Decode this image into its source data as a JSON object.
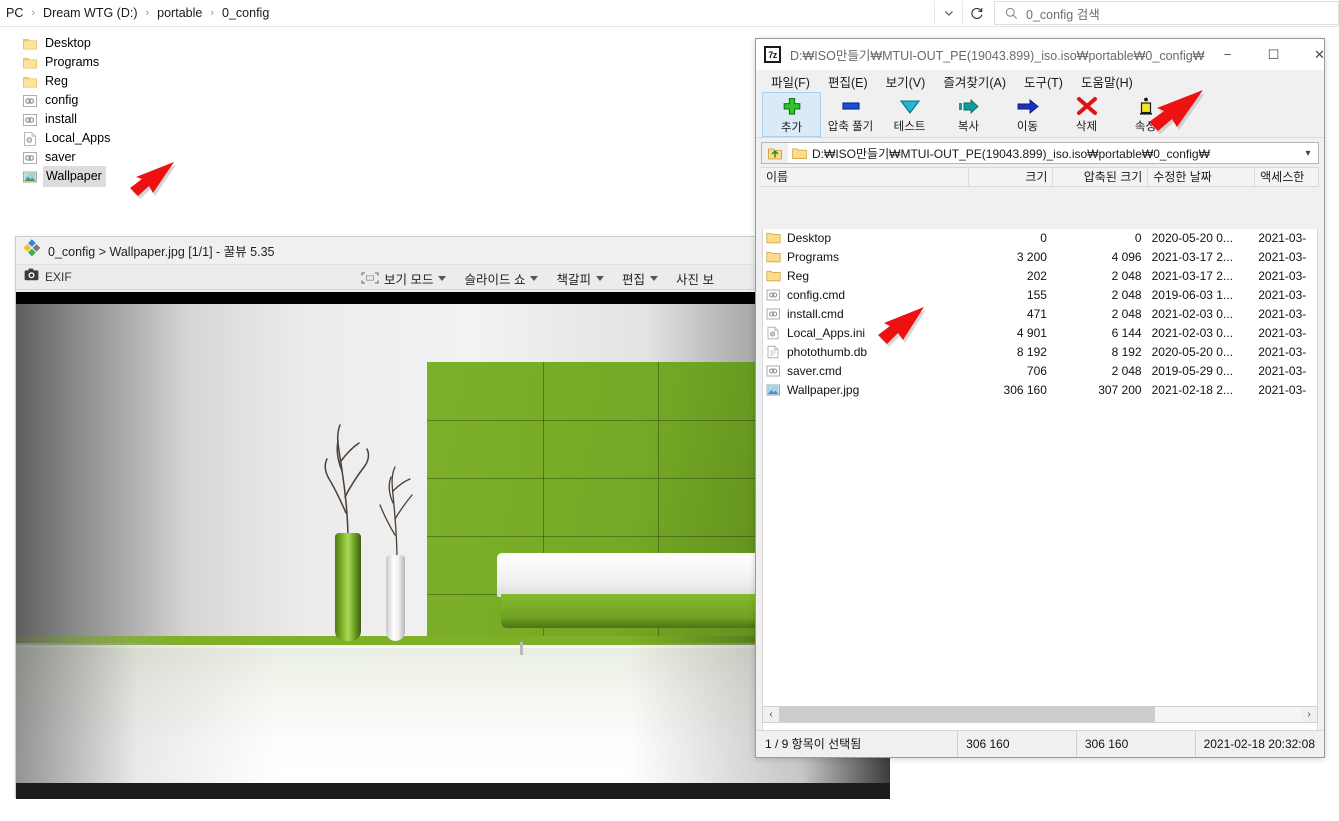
{
  "explorer": {
    "breadcrumb": {
      "items": [
        "PC",
        "Dream WTG (D:)",
        "portable",
        "0_config"
      ],
      "separator": "›"
    },
    "addressbar": {
      "dropdown_icon": "chevron-down-icon",
      "refresh_icon": "refresh-icon"
    },
    "search": {
      "placeholder": "0_config 검색",
      "value": "0_config 검색",
      "icon": "search-icon"
    },
    "items": [
      {
        "label": "Desktop",
        "icon": "folder-icon",
        "selected": false
      },
      {
        "label": "Programs",
        "icon": "folder-icon",
        "selected": false
      },
      {
        "label": "Reg",
        "icon": "folder-icon",
        "selected": false
      },
      {
        "label": "config",
        "icon": "cmd-file-icon",
        "selected": false
      },
      {
        "label": "install",
        "icon": "cmd-file-icon",
        "selected": false
      },
      {
        "label": "Local_Apps",
        "icon": "ini-file-icon",
        "selected": false
      },
      {
        "label": "saver",
        "icon": "cmd-file-icon",
        "selected": false
      },
      {
        "label": "Wallpaper",
        "icon": "image-file-icon",
        "selected": true
      }
    ]
  },
  "viewer": {
    "title": "0_config > Wallpaper.jpg [1/1] - 꿀뷰 5.35",
    "app_icon": "kkulview-diamond-icon",
    "toolbar": {
      "exif_label": "EXIF",
      "exif_icon": "camera-icon",
      "buttons": [
        {
          "label": "보기 모드",
          "icon": "fit-screen-icon",
          "has_caret": true
        },
        {
          "label": "슬라이드 쇼",
          "icon": "",
          "has_caret": true
        },
        {
          "label": "책갈피",
          "icon": "",
          "has_caret": true
        },
        {
          "label": "편집",
          "icon": "",
          "has_caret": true
        },
        {
          "label": "사진 보",
          "icon": "",
          "has_caret": false
        }
      ]
    },
    "image_description": "녹색 벽과 흰색 소파가 있는 인테리어 사진"
  },
  "sevenzip": {
    "title": "D:₩ISO만들기₩MTUI-OUT_PE(19043.899)_iso.iso₩portable₩0_config₩",
    "app_icon": "7z-icon",
    "window_controls": {
      "minimize": "−",
      "maximize": "☐",
      "close": "✕"
    },
    "menu": [
      "파일(F)",
      "편집(E)",
      "보기(V)",
      "즐겨찾기(A)",
      "도구(T)",
      "도움말(H)"
    ],
    "toolbar": [
      {
        "label": "추가",
        "icon": "plus-green-icon",
        "active": true
      },
      {
        "label": "압축 풀기",
        "icon": "extract-blue-icon",
        "active": false
      },
      {
        "label": "테스트",
        "icon": "test-chevron-icon",
        "active": false
      },
      {
        "label": "복사",
        "icon": "copy-arrow-icon",
        "active": false
      },
      {
        "label": "이동",
        "icon": "move-arrow-icon",
        "active": false
      },
      {
        "label": "삭제",
        "icon": "delete-x-icon",
        "active": false
      },
      {
        "label": "속성",
        "icon": "info-i-icon",
        "active": false
      }
    ],
    "address": {
      "value": "D:₩ISO만들기₩MTUI-OUT_PE(19043.899)_iso.iso₩portable₩0_config₩",
      "up_icon": "up-folder-icon",
      "folder_icon": "folder-icon",
      "dropdown_icon": "chevron-down-icon"
    },
    "columns": [
      "이름",
      "크기",
      "압축된 크기",
      "수정한 날짜",
      "액세스한"
    ],
    "rows": [
      {
        "name": "Desktop",
        "icon": "folder-icon",
        "size": "0",
        "packed": "0",
        "modified": "2020-05-20 0...",
        "accessed": "2021-03-"
      },
      {
        "name": "Programs",
        "icon": "folder-icon",
        "size": "3 200",
        "packed": "4 096",
        "modified": "2021-03-17 2...",
        "accessed": "2021-03-"
      },
      {
        "name": "Reg",
        "icon": "folder-icon",
        "size": "202",
        "packed": "2 048",
        "modified": "2021-03-17 2...",
        "accessed": "2021-03-"
      },
      {
        "name": "config.cmd",
        "icon": "cmd-file-icon",
        "size": "155",
        "packed": "2 048",
        "modified": "2019-06-03 1...",
        "accessed": "2021-03-"
      },
      {
        "name": "install.cmd",
        "icon": "cmd-file-icon",
        "size": "471",
        "packed": "2 048",
        "modified": "2021-02-03 0...",
        "accessed": "2021-03-"
      },
      {
        "name": "Local_Apps.ini",
        "icon": "ini-file-icon",
        "size": "4 901",
        "packed": "6 144",
        "modified": "2021-02-03 0...",
        "accessed": "2021-03-"
      },
      {
        "name": "photothumb.db",
        "icon": "db-file-icon",
        "size": "8 192",
        "packed": "8 192",
        "modified": "2020-05-20 0...",
        "accessed": "2021-03-"
      },
      {
        "name": "saver.cmd",
        "icon": "cmd-file-icon",
        "size": "706",
        "packed": "2 048",
        "modified": "2019-05-29 0...",
        "accessed": "2021-03-"
      },
      {
        "name": "Wallpaper.jpg",
        "icon": "image-file-icon",
        "size": "306 160",
        "packed": "307 200",
        "modified": "2021-02-18 2...",
        "accessed": "2021-03-"
      }
    ],
    "status": [
      "1 / 9 항목이 선택됨",
      "306 160",
      "306 160",
      "2021-02-18 20:32:08"
    ],
    "scrollbar": {
      "left_arrow": "‹",
      "right_arrow": "›"
    }
  },
  "annotations": [
    {
      "name": "arrow-to-wallpaper-explorer",
      "color": "#ee1111"
    },
    {
      "name": "arrow-to-properties-toolbar",
      "color": "#ee1111"
    },
    {
      "name": "arrow-to-wallpaper-row",
      "color": "#ee1111"
    }
  ],
  "colors": {
    "accent_green": "#7cb02a",
    "arrow_red": "#ee1111",
    "selection": "#dcdcdc"
  }
}
